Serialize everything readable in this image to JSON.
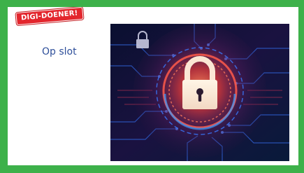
{
  "badge": {
    "label": "DIGI-DOENER!"
  },
  "title": "Op slot",
  "colors": {
    "frame_green": "#3db14a",
    "badge_red": "#e3262d",
    "title_blue": "#2e4f9a"
  },
  "image": {
    "icons": [
      "padlock-icon",
      "small-padlock-icon"
    ]
  }
}
